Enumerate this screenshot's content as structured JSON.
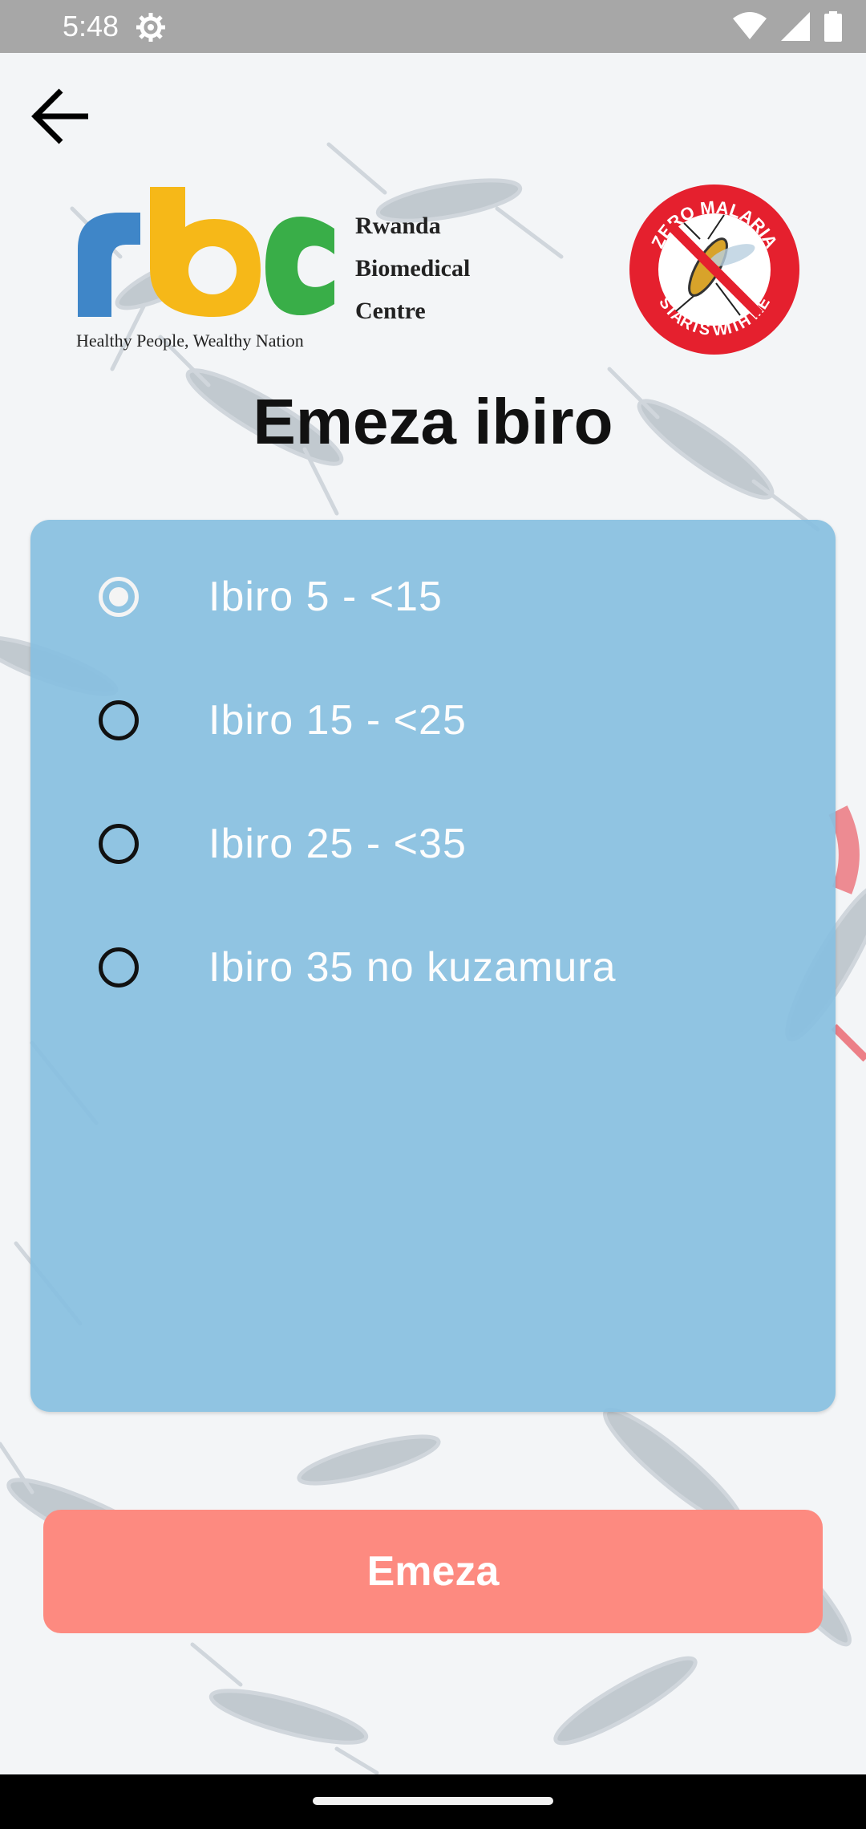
{
  "status_bar": {
    "time": "5:48",
    "icons": [
      "settings-gear-icon",
      "wifi-icon",
      "signal-icon",
      "battery-icon"
    ]
  },
  "header": {
    "back_icon": "arrow-left-icon",
    "rbc_logo": {
      "letters": "rbc",
      "name_line1": "Rwanda",
      "name_line2": "Biomedical",
      "name_line3": "Centre",
      "tagline": "Healthy People, Wealthy Nation",
      "colors": {
        "r": "#3f86c8",
        "b": "#f6b818",
        "c": "#39ae48"
      }
    },
    "zero_malaria_logo": {
      "top_text": "ZERO MALARIA",
      "bottom_text": "STARTS WITH ME",
      "color": "#e5202e"
    }
  },
  "title": "Emeza ibiro",
  "weight_options": {
    "selected_index": 0,
    "items": [
      {
        "label": "Ibiro 5 - <15"
      },
      {
        "label": "Ibiro 15 - <25"
      },
      {
        "label": "Ibiro 25 - <35"
      },
      {
        "label": "Ibiro 35 no kuzamura"
      }
    ]
  },
  "submit_button": {
    "label": "Emeza",
    "color": "#fd8a80"
  },
  "colors": {
    "card": "#8fc3e1",
    "status_bar": "#a7a7a7"
  }
}
